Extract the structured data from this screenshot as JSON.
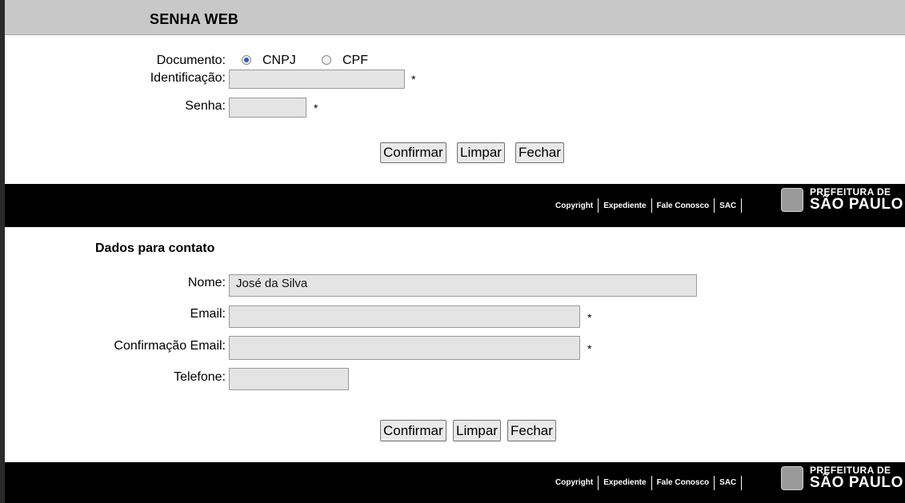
{
  "login": {
    "title": "SENHA WEB",
    "documento_label": "Documento:",
    "cnpj_label": "CNPJ",
    "cpf_label": "CPF",
    "identificacao_label": "Identificação:",
    "identificacao_value": "",
    "senha_label": "Senha:",
    "senha_value": "",
    "required_mark": "*",
    "buttons": {
      "confirm": "Confirmar",
      "clear": "Limpar",
      "close": "Fechar"
    }
  },
  "contact": {
    "section_title": "Dados para contato",
    "nome_label": "Nome:",
    "nome_value": "José da Silva",
    "email_label": "Email:",
    "email_value": "",
    "confirm_email_label": "Confirmação Email:",
    "confirm_email_value": "",
    "telefone_label": "Telefone:",
    "telefone_value": "",
    "required_mark": "*",
    "buttons": {
      "confirm": "Confirmar",
      "clear": "Limpar",
      "close": "Fechar"
    }
  },
  "footer": {
    "links": [
      "Copyright",
      "Expediente",
      "Fale Conosco",
      "SAC"
    ],
    "logo_line1": "PREFEITURA DE",
    "logo_line2": "SÃO PAULO"
  },
  "colors": {
    "title_bar": "#c8c8c8",
    "footer_bg": "#000000",
    "field_bg": "#e4e4e4",
    "radio_selected": "#2a57c9"
  }
}
